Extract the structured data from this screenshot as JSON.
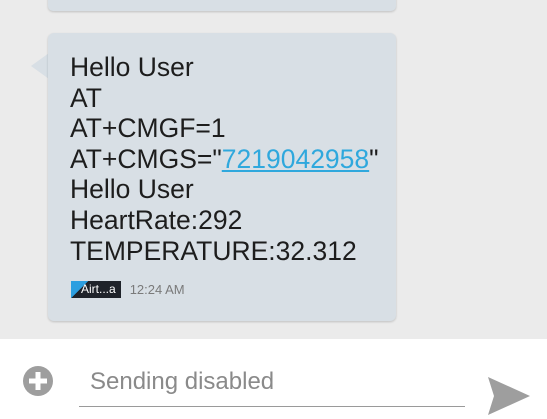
{
  "message": {
    "lines": [
      "Hello User",
      "AT",
      "AT+CMGF=1",
      "Hello User",
      "HeartRate:292",
      "TEMPERATURE:32.312"
    ],
    "cmgs_prefix": "AT+CMGS=\"",
    "phone_number": "7219042958",
    "cmgs_suffix": "\"",
    "sim_label": "Airt...a",
    "time": "12:24 AM"
  },
  "compose": {
    "placeholder": "Sending disabled"
  },
  "icons": {
    "attach": "add-circle-icon",
    "send": "send-icon"
  },
  "colors": {
    "bubble": "#d8dfe5",
    "link": "#2fa8dd",
    "conversation_background": "#ebebeb",
    "send_icon": "#9e9e9e"
  }
}
